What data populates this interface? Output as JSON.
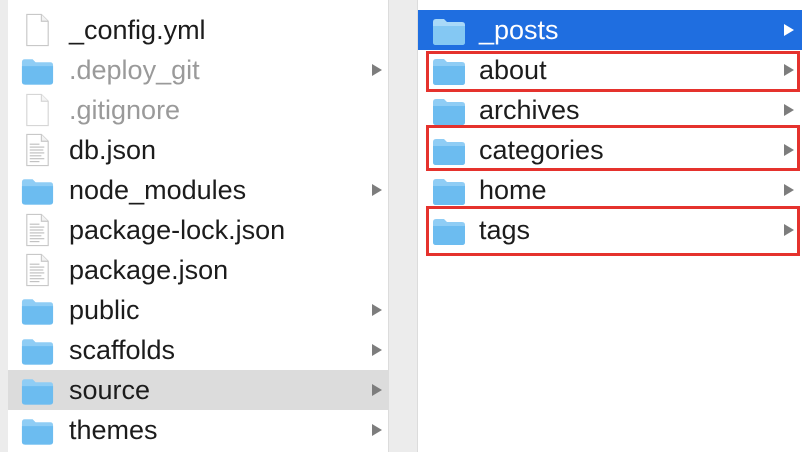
{
  "left_column": {
    "items": [
      {
        "name": "_config.yml",
        "kind": "file",
        "icon": "text-file-icon",
        "dim": false,
        "has_children": false
      },
      {
        "name": ".deploy_git",
        "kind": "folder",
        "icon": "folder-icon",
        "dim": true,
        "has_children": true
      },
      {
        "name": ".gitignore",
        "kind": "file",
        "icon": "blank-file-icon",
        "dim": true,
        "has_children": false
      },
      {
        "name": "db.json",
        "kind": "file",
        "icon": "text-file-icon",
        "dim": false,
        "has_children": false
      },
      {
        "name": "node_modules",
        "kind": "folder",
        "icon": "folder-icon",
        "dim": false,
        "has_children": true
      },
      {
        "name": "package-lock.json",
        "kind": "file",
        "icon": "text-file-icon",
        "dim": false,
        "has_children": false
      },
      {
        "name": "package.json",
        "kind": "file",
        "icon": "text-file-icon",
        "dim": false,
        "has_children": false
      },
      {
        "name": "public",
        "kind": "folder",
        "icon": "folder-icon",
        "dim": false,
        "has_children": true
      },
      {
        "name": "scaffolds",
        "kind": "folder",
        "icon": "folder-icon",
        "dim": false,
        "has_children": true
      },
      {
        "name": "source",
        "kind": "folder",
        "icon": "folder-icon",
        "dim": false,
        "has_children": true,
        "selected": true
      },
      {
        "name": "themes",
        "kind": "folder",
        "icon": "folder-icon",
        "dim": false,
        "has_children": true
      }
    ]
  },
  "right_column": {
    "items": [
      {
        "name": "_posts",
        "kind": "folder",
        "icon": "folder-icon",
        "has_children": true,
        "selected": true,
        "highlighted": false
      },
      {
        "name": "about",
        "kind": "folder",
        "icon": "folder-icon",
        "has_children": true,
        "highlighted": true
      },
      {
        "name": "archives",
        "kind": "folder",
        "icon": "folder-icon",
        "has_children": true,
        "highlighted": false
      },
      {
        "name": "categories",
        "kind": "folder",
        "icon": "folder-icon",
        "has_children": true,
        "highlighted": true
      },
      {
        "name": "home",
        "kind": "folder",
        "icon": "folder-icon",
        "has_children": true,
        "highlighted": false
      },
      {
        "name": "tags",
        "kind": "folder",
        "icon": "folder-icon",
        "has_children": true,
        "highlighted": true
      }
    ]
  },
  "colors": {
    "selection_blue": "#1f6ee0",
    "selection_gray": "#dcdcdc",
    "folder_blue": "#6cbcf0",
    "highlight_red": "#e5322d"
  }
}
